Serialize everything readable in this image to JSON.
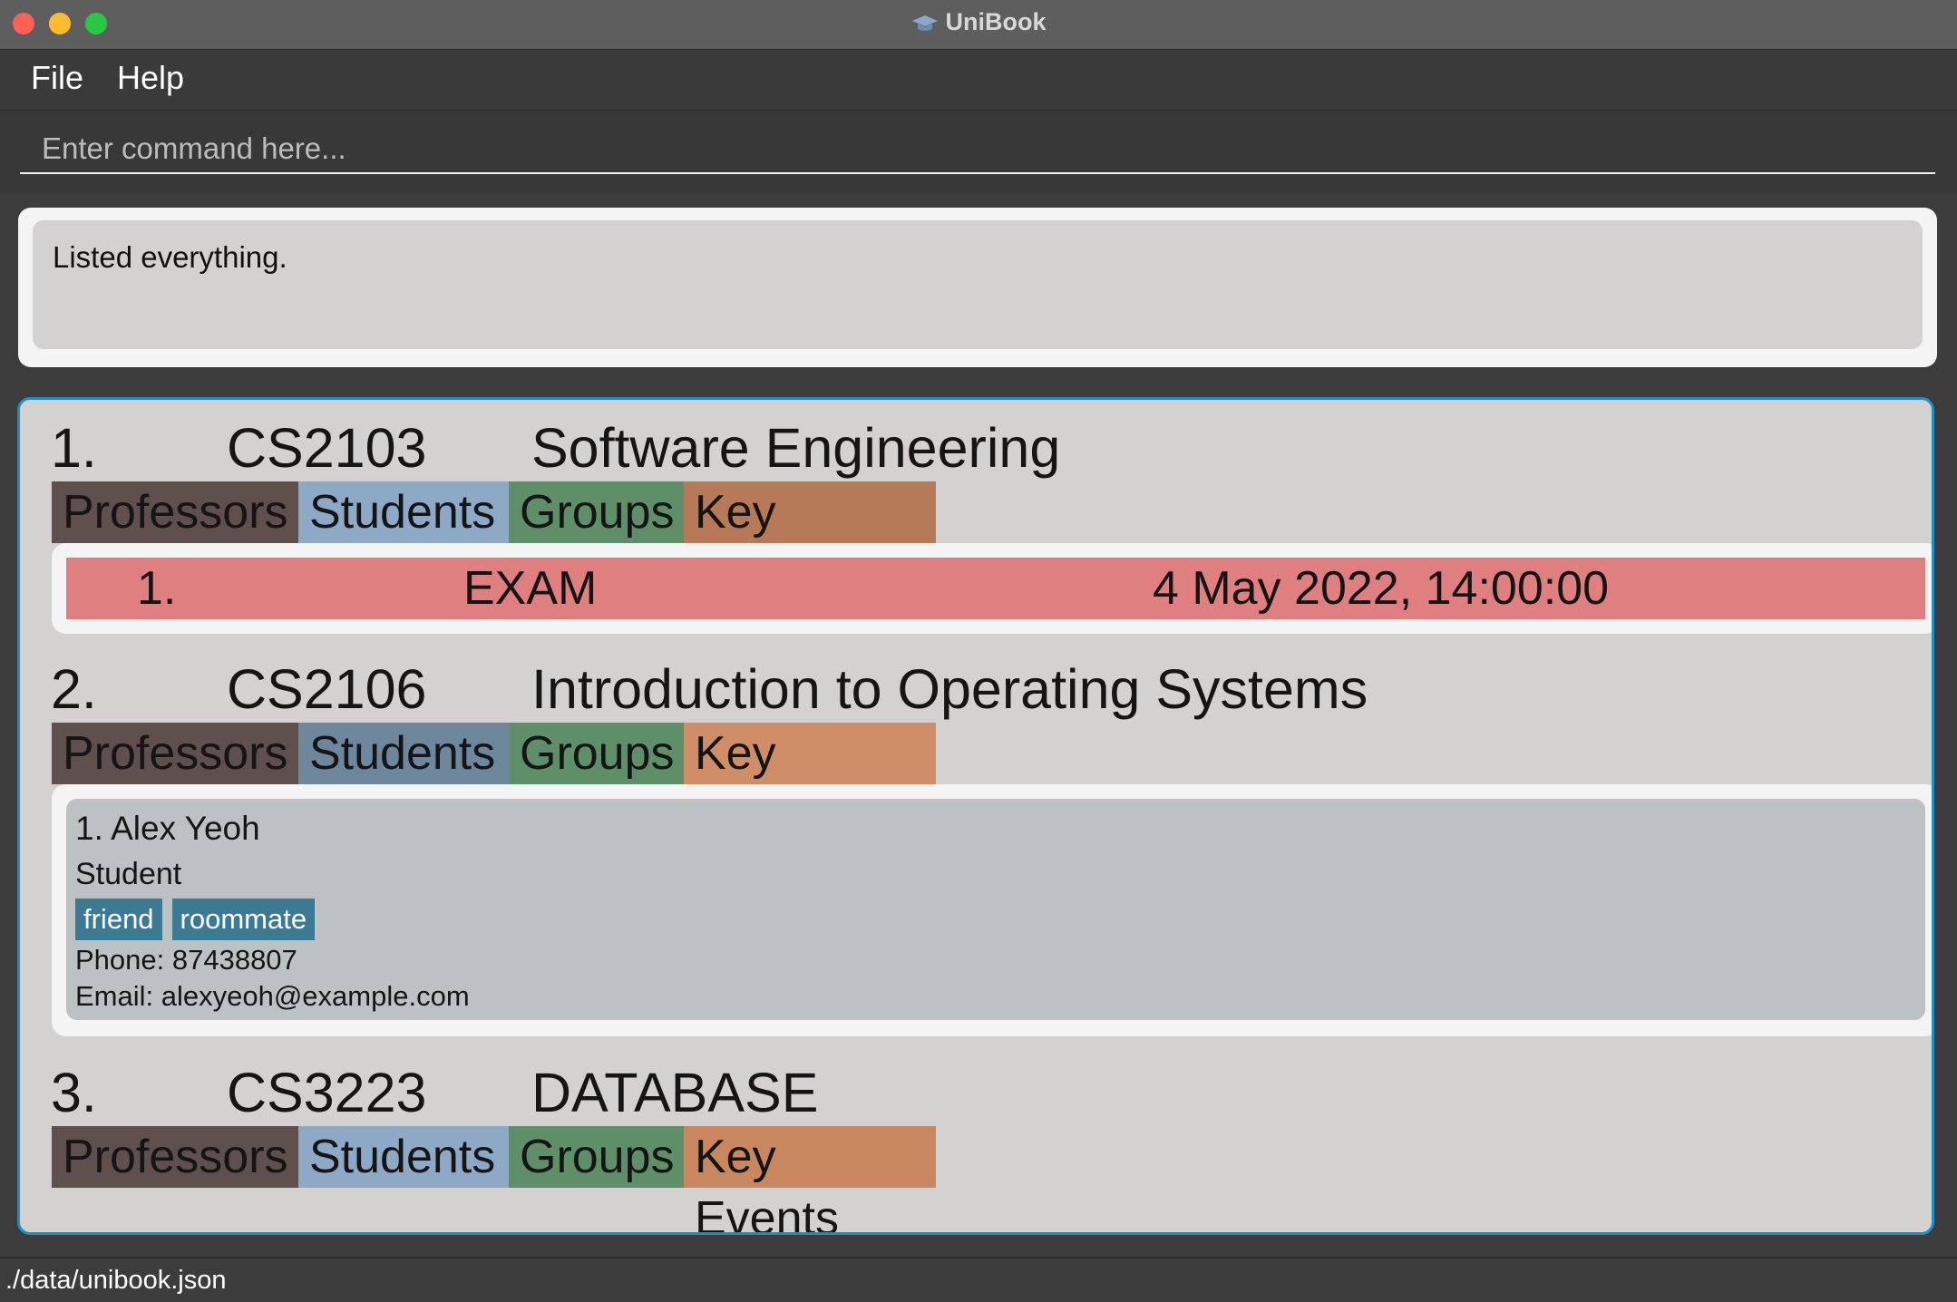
{
  "window": {
    "title": "UniBook"
  },
  "menu": [
    {
      "label": "File"
    },
    {
      "label": "Help"
    }
  ],
  "command": {
    "placeholder": "Enter command here...",
    "value": ""
  },
  "result": {
    "text": "Listed everything."
  },
  "modules": [
    {
      "index": "1.",
      "code": "CS2103",
      "name": "Software Engineering",
      "tabs": {
        "professors": "Professors",
        "students": "Students",
        "groups": "Groups",
        "key_events": "Key Events"
      },
      "events": [
        {
          "index": "1.",
          "type": "EXAM",
          "datetime": "4 May 2022, 14:00:00"
        }
      ]
    },
    {
      "index": "2.",
      "code": "CS2106",
      "name": "Introduction to Operating Systems",
      "tabs": {
        "professors": "Professors",
        "students": "Students",
        "groups": "Groups",
        "key_events": "Key Events"
      },
      "people": [
        {
          "index_name": "1.  Alex Yeoh",
          "role": "Student",
          "tags": [
            "friend",
            "roommate"
          ],
          "phone": "Phone: 87438807",
          "email": "Email: alexyeoh@example.com"
        }
      ]
    },
    {
      "index": "3.",
      "code": "CS3223",
      "name": "DATABASE",
      "tabs": {
        "professors": "Professors",
        "students": "Students",
        "groups": "Groups",
        "key_events": "Key Events"
      }
    }
  ],
  "status": {
    "path": "./data/unibook.json"
  },
  "colors": {
    "list_border": "#1c8fc9",
    "event_row": "#e07f7f",
    "tag": "#3b7a92"
  }
}
